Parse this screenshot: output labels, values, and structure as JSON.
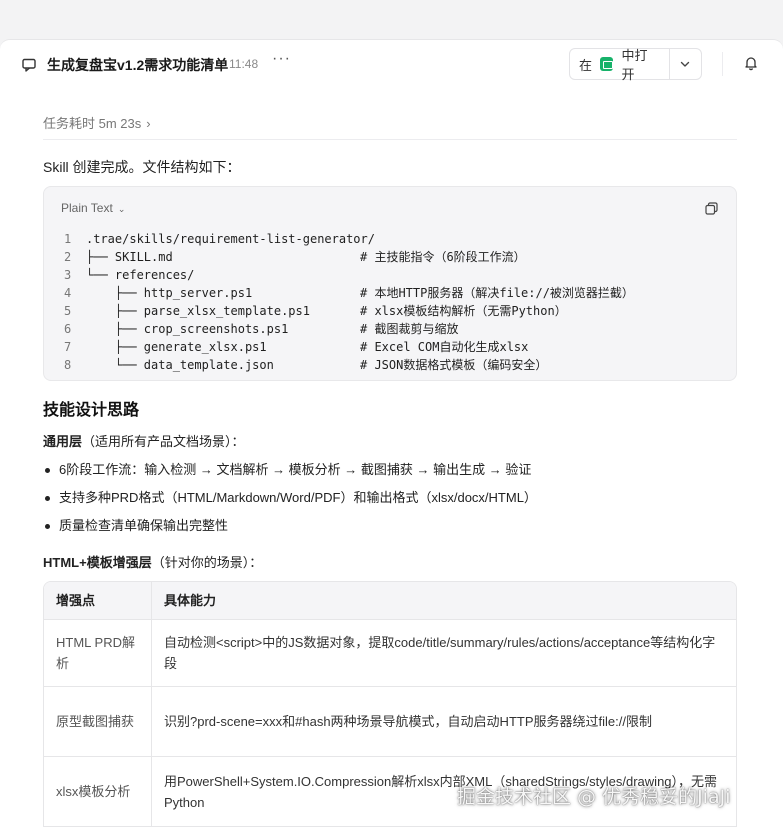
{
  "header": {
    "title": "生成复盘宝v1.2需求功能清单",
    "time": "11:48",
    "more_label": "···",
    "open_prefix": "在",
    "open_label": "中打开"
  },
  "task": {
    "duration_label": "任务耗时 5m 23s"
  },
  "intro": "Skill 创建完成。文件结构如下：",
  "code_block": {
    "language": "Plain Text",
    "lines": [
      {
        "n": "1",
        "text": ".trae/skills/requirement-list-generator/",
        "comment": ""
      },
      {
        "n": "2",
        "text": "├── SKILL.md",
        "comment": "# 主技能指令（6阶段工作流）"
      },
      {
        "n": "3",
        "text": "└── references/",
        "comment": ""
      },
      {
        "n": "4",
        "text": "    ├── http_server.ps1",
        "comment": "# 本地HTTP服务器（解决file://被浏览器拦截）"
      },
      {
        "n": "5",
        "text": "    ├── parse_xlsx_template.ps1",
        "comment": "# xlsx模板结构解析（无需Python）"
      },
      {
        "n": "6",
        "text": "    ├── crop_screenshots.ps1",
        "comment": "# 截图裁剪与缩放"
      },
      {
        "n": "7",
        "text": "    ├── generate_xlsx.ps1",
        "comment": "# Excel COM自动化生成xlsx"
      },
      {
        "n": "8",
        "text": "    └── data_template.json",
        "comment": "# JSON数据格式模板（编码安全）"
      }
    ]
  },
  "design": {
    "heading": "技能设计思路",
    "general_bold": "通用层",
    "general_rest": "（适用所有产品文档场景）：",
    "bullets": [
      "6阶段工作流：输入检测 → 文档解析 → 模板分析 → 截图捕获 → 输出生成 → 验证",
      "支持多种PRD格式（HTML/Markdown/Word/PDF）和输出格式（xlsx/docx/HTML）",
      "质量检查清单确保输出完整性"
    ],
    "enhanced_bold": "HTML+模板增强层",
    "enhanced_rest": "（针对你的场景）："
  },
  "table": {
    "headers": [
      "增强点",
      "具体能力"
    ],
    "rows": [
      {
        "point": "HTML PRD解析",
        "ability": "自动检测<script>中的JS数据对象，提取code/title/summary/rules/actions/acceptance等结构化字段"
      },
      {
        "point": "原型截图捕获",
        "ability": "识别?prd-scene=xxx和#hash两种场景导航模式，自动启动HTTP服务器绕过file://限制"
      },
      {
        "point": "xlsx模板分析",
        "ability": "用PowerShell+System.IO.Compression解析xlsx内部XML（sharedStrings/styles/drawing），无需Python"
      }
    ]
  },
  "watermark": "掘金技术社区 @ 优秀稳妥的JiaJi"
}
